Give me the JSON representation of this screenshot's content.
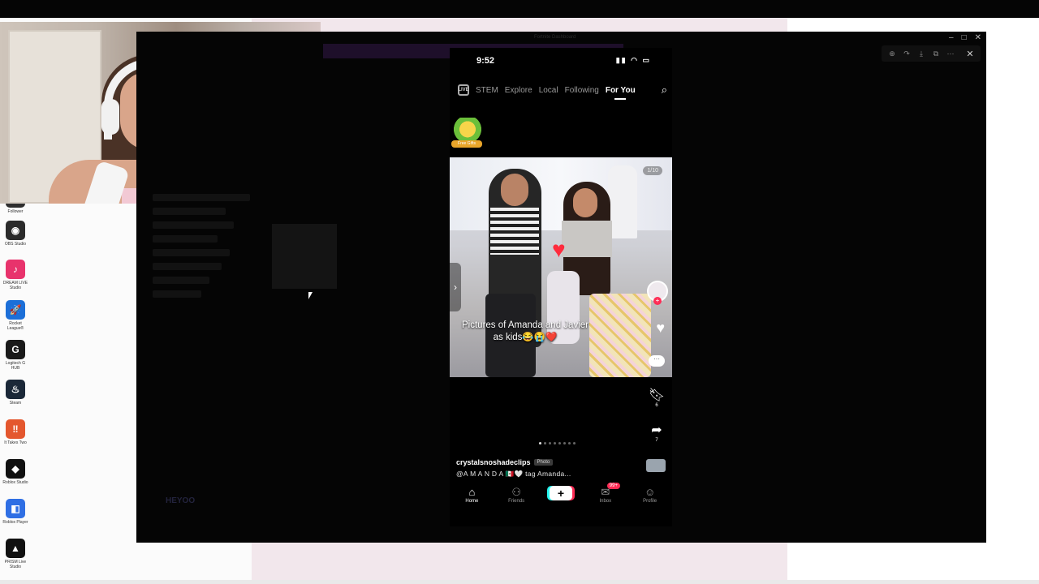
{
  "desktop": {
    "icons": [
      {
        "label": "Follower",
        "color": "#2f2f2f",
        "glyph": ""
      },
      {
        "label": "OBS Studio",
        "color": "#2b2b2b",
        "glyph": "◉"
      },
      {
        "label": "DREAM LIVE Studio",
        "color": "#e8336c",
        "glyph": "♪"
      },
      {
        "label": "Rocket League®",
        "color": "#1c6fd8",
        "glyph": "🚀"
      },
      {
        "label": "Logitech G HUB",
        "color": "#1a1a1a",
        "glyph": "G"
      },
      {
        "label": "Steam",
        "color": "#1b2838",
        "glyph": "♨"
      },
      {
        "label": "It Takes Two",
        "color": "#e4572e",
        "glyph": "‼"
      },
      {
        "label": "Roblox Studio",
        "color": "#111111",
        "glyph": "◆"
      },
      {
        "label": "Roblox Player",
        "color": "#2f6fe4",
        "glyph": "◧"
      },
      {
        "label": "PRISM Live Studio",
        "color": "#111111",
        "glyph": "▲"
      }
    ]
  },
  "window": {
    "title": "Fortnite Dashboard",
    "faded_logo": "HEYOO",
    "viewer_tools": [
      "⊕",
      "↷",
      "⤓",
      "⧉",
      "⋯"
    ],
    "viewer_close": "✕"
  },
  "phone": {
    "time": "9:52",
    "status_icons": "▮▮ ◠ ▭",
    "nav": {
      "live_label": "LIVE",
      "tabs": [
        "STEM",
        "Explore",
        "Local",
        "Following",
        "For You"
      ],
      "active_tab": "For You"
    },
    "gift_label": "Free Gifts",
    "post": {
      "counter": "1/10",
      "caption": "Pictures of Amanda and Javier as kids😂😭❤️",
      "actions": {
        "like_count": "",
        "comment_count": "",
        "save_count": "6",
        "share_count": "7"
      },
      "username": "crystalsnoshadeclips",
      "badge": "Photo",
      "description": "@A M A N D A 🇲🇽🤍 tag Amanda..."
    },
    "bottom_nav": {
      "home": "Home",
      "friends": "Friends",
      "inbox": "Inbox",
      "inbox_badge": "99+",
      "profile": "Profile"
    }
  }
}
